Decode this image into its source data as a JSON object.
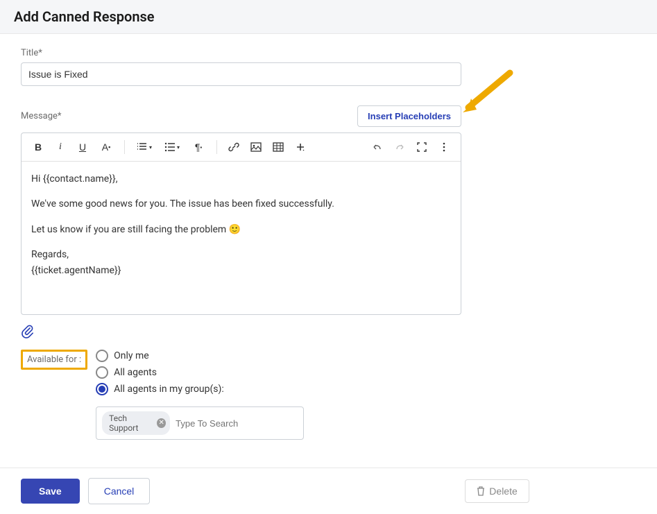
{
  "header": {
    "title": "Add Canned Response"
  },
  "title_field": {
    "label": "Title*",
    "value": "Issue is Fixed"
  },
  "message": {
    "label": "Message*",
    "insert_btn": "Insert Placeholders",
    "body": {
      "greeting": "Hi {{contact.name}},",
      "line1": "We've some good news for you. The issue has been fixed successfully.",
      "line2_a": "Let us know if you are still facing the problem ",
      "line2_emoji": "🙂",
      "signoff": "Regards,",
      "agent": "{{ticket.agentName}}"
    }
  },
  "availability": {
    "label": "Available for :",
    "options": [
      {
        "label": "Only me",
        "selected": false
      },
      {
        "label": "All agents",
        "selected": false
      },
      {
        "label": "All agents in my group(s):",
        "selected": true
      }
    ],
    "tag": "Tech Support",
    "search_placeholder": "Type To Search"
  },
  "footer": {
    "save": "Save",
    "cancel": "Cancel",
    "delete": "Delete"
  }
}
